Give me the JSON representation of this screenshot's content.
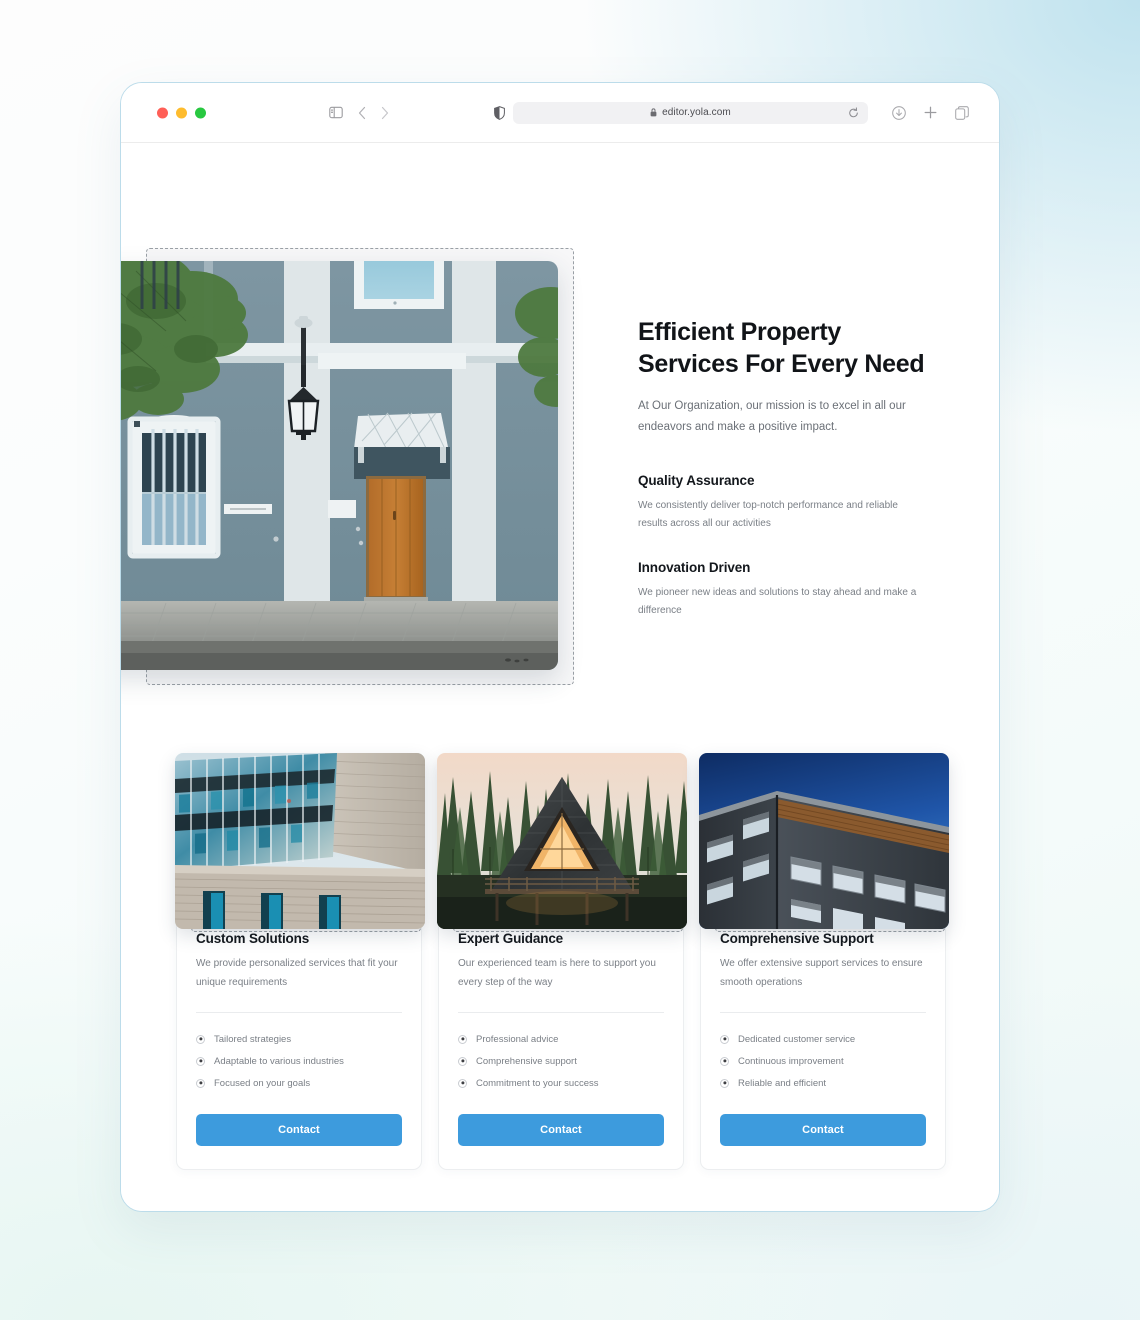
{
  "browser": {
    "traffic_lights": [
      "close",
      "minimize",
      "maximize"
    ],
    "url": "editor.yola.com",
    "left_icons": [
      "sidebar-icon",
      "back-icon",
      "forward-icon"
    ],
    "right_icons": [
      "downloads-icon",
      "new-tab-icon",
      "tab-overview-icon"
    ],
    "address_icons": [
      "lock-icon",
      "reload-icon",
      "shield-icon"
    ]
  },
  "hero": {
    "title": "Efficient Property Services For Every Need",
    "subtitle": "At Our Organization, our mission is to excel in all our endeavors and make a positive impact.",
    "image_alt": "blue-building-facade-with-wooden-door",
    "features": [
      {
        "title": "Quality Assurance",
        "desc": "We consistently deliver top-notch performance and reliable results across all our activities"
      },
      {
        "title": "Innovation Driven",
        "desc": "We pioneer new ideas and solutions to stay ahead and make a difference"
      }
    ]
  },
  "cards": [
    {
      "image_alt": "modern-glass-office-building",
      "title": "Custom Solutions",
      "desc": "We provide personalized services that fit your unique requirements",
      "items": [
        "Tailored strategies",
        "Adaptable to various industries",
        "Focused on your goals"
      ],
      "button": "Contact"
    },
    {
      "image_alt": "a-frame-cabin-in-forest-at-dusk",
      "title": "Expert Guidance",
      "desc": "Our experienced team is here to support you every step of the way",
      "items": [
        "Professional advice",
        "Comprehensive support",
        "Commitment to your success"
      ],
      "button": "Contact"
    },
    {
      "image_alt": "dark-modern-apartment-block-against-blue-sky",
      "title": "Comprehensive Support",
      "desc": "We offer extensive support services to ensure smooth operations",
      "items": [
        "Dedicated customer service",
        "Continuous improvement",
        "Reliable and efficient"
      ],
      "button": "Contact"
    }
  ],
  "colors": {
    "accent_blue": "#3d9bdd",
    "window_border": "#bcdcea",
    "heading": "#13171c",
    "body_text": "#7a7f86",
    "selection_dash": "#9aa0a6"
  }
}
